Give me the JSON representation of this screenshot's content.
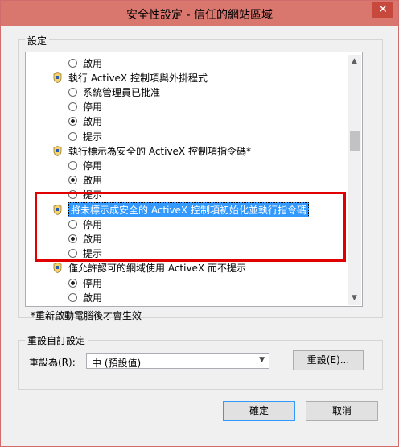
{
  "window": {
    "title": "安全性設定 - 信任的網站區域",
    "close": "✕"
  },
  "settings": {
    "group_label": "設定",
    "rows": [
      {
        "kind": "radio",
        "label": "啟用",
        "checked": false
      },
      {
        "kind": "setting",
        "label": "執行 ActiveX 控制項與外掛程式"
      },
      {
        "kind": "radio",
        "label": "系統管理員已批准",
        "checked": false
      },
      {
        "kind": "radio",
        "label": "停用",
        "checked": false
      },
      {
        "kind": "radio",
        "label": "啟用",
        "checked": true
      },
      {
        "kind": "radio",
        "label": "提示",
        "checked": false
      },
      {
        "kind": "setting",
        "label": "執行標示為安全的 ActiveX 控制項指令碼*"
      },
      {
        "kind": "radio",
        "label": "停用",
        "checked": false
      },
      {
        "kind": "radio",
        "label": "啟用",
        "checked": true
      },
      {
        "kind": "radio",
        "label": "提示",
        "checked": false
      },
      {
        "kind": "setting",
        "label": "將未標示成安全的 ActiveX 控制項初始化並執行指令碼",
        "selected": true
      },
      {
        "kind": "radio",
        "label": "停用",
        "checked": false
      },
      {
        "kind": "radio",
        "label": "啟用",
        "checked": true
      },
      {
        "kind": "radio",
        "label": "提示",
        "checked": false
      },
      {
        "kind": "setting",
        "label": "僅允許認可的網域使用 ActiveX 而不提示"
      },
      {
        "kind": "radio",
        "label": "停用",
        "checked": true
      },
      {
        "kind": "radio",
        "label": "啟用",
        "checked": false
      }
    ],
    "note": "*重新啟動電腦後才會生效"
  },
  "reset": {
    "group_label": "重設自訂設定",
    "reset_to_label": "重設為(R):",
    "level_value": "中 (預設值)",
    "reset_button": "重設(E)..."
  },
  "buttons": {
    "ok": "確定",
    "cancel": "取消"
  },
  "colors": {
    "titlebar": "#d9776f",
    "selection": "#3399ff",
    "annotation": "#e00000"
  }
}
